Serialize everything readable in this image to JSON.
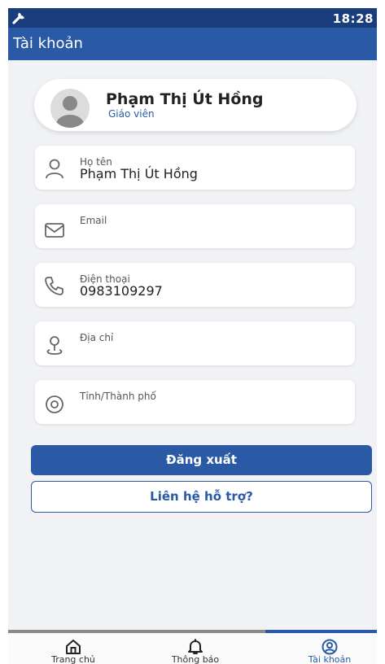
{
  "status_bar": {
    "time": "18:28",
    "wrench_icon": "wrench-icon"
  },
  "header": {
    "title": "Tài khoản"
  },
  "profile": {
    "name": "Phạm Thị Út Hồng",
    "role": "Giáo viên",
    "avatar_icon": "user-avatar"
  },
  "fields": [
    {
      "icon": "person-icon",
      "label": "Họ tên",
      "value": "Phạm Thị Út Hồng"
    },
    {
      "icon": "mail-icon",
      "label": "Email",
      "value": ""
    },
    {
      "icon": "phone-icon",
      "label": "Điện thoại",
      "value": "0983109297"
    },
    {
      "icon": "location-person-icon",
      "label": "Địa chỉ",
      "value": ""
    },
    {
      "icon": "map-pin-icon",
      "label": "Tỉnh/Thành phố",
      "value": ""
    }
  ],
  "actions": {
    "logout_label": "Đăng xuất",
    "support_label": "Liên hệ hỗ trợ?"
  },
  "bottom_nav": {
    "items": [
      {
        "label": "Trang chủ",
        "icon": "home-icon",
        "active": false
      },
      {
        "label": "Thông báo",
        "icon": "bell-icon",
        "active": false
      },
      {
        "label": "Tài khoản",
        "icon": "account-icon",
        "active": true
      }
    ]
  },
  "colors": {
    "primary": "#2a5aa6",
    "status_bar": "#1a3d7c",
    "background": "#f1f2f6"
  }
}
